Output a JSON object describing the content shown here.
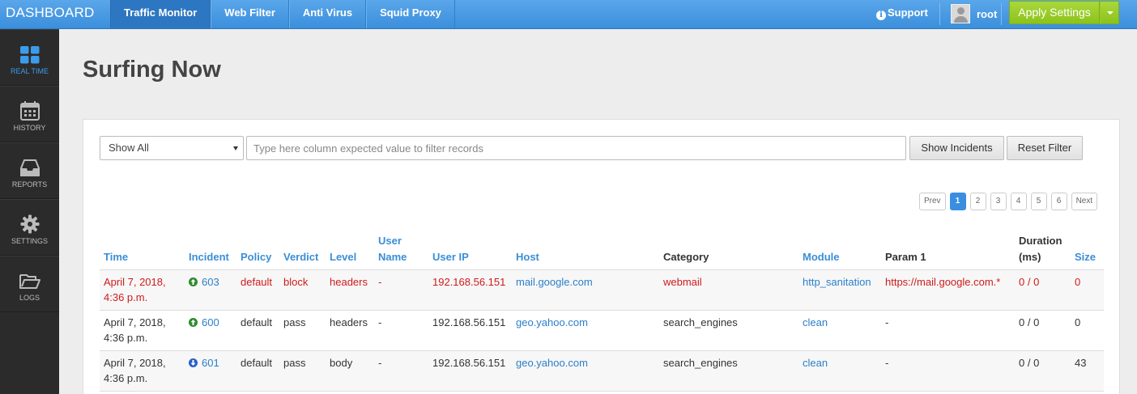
{
  "header": {
    "brand": "DASHBOARD",
    "tabs": [
      {
        "label": "Traffic Monitor",
        "active": true
      },
      {
        "label": "Web Filter"
      },
      {
        "label": "Anti Virus"
      },
      {
        "label": "Squid Proxy"
      }
    ],
    "support_label": "Support",
    "user_name": "root",
    "apply_label": "Apply Settings"
  },
  "sidebar": {
    "items": [
      {
        "label": "REAL TIME",
        "icon": "grid-icon",
        "active": true
      },
      {
        "label": "HISTORY",
        "icon": "calendar-icon"
      },
      {
        "label": "REPORTS",
        "icon": "inbox-icon"
      },
      {
        "label": "SETTINGS",
        "icon": "gear-icon"
      },
      {
        "label": "LOGS",
        "icon": "folder-icon"
      }
    ]
  },
  "main": {
    "title": "Surfing Now",
    "filter": {
      "select_value": "Show All",
      "input_placeholder": "Type here column expected value to filter records",
      "show_incidents_label": "Show Incidents",
      "reset_label": "Reset Filter"
    },
    "pager": {
      "prev": "Prev",
      "pages": [
        "1",
        "2",
        "3",
        "4",
        "5",
        "6"
      ],
      "current": "1",
      "next": "Next"
    },
    "table": {
      "headers": {
        "time": "Time",
        "incident": "Incident",
        "policy": "Policy",
        "verdict": "Verdict",
        "level": "Level",
        "user_name_1": "User",
        "user_name_2": "Name",
        "user_ip": "User IP",
        "host": "Host",
        "category": "Category",
        "module": "Module",
        "param1": "Param 1",
        "duration_1": "Duration",
        "duration_2": "(ms)",
        "size": "Size"
      },
      "rows": [
        {
          "time_1": "April 7, 2018,",
          "time_2": "4:36 p.m.",
          "incident": "603",
          "incident_dir": "up",
          "policy": "default",
          "verdict": "block",
          "level": "headers",
          "user_name": "-",
          "user_ip": "192.168.56.151",
          "host": "mail.google.com",
          "category": "webmail",
          "module": "http_sanitation",
          "param1": "https://mail.google.com.*",
          "duration": "0 / 0",
          "size": "0",
          "status_color": "#d01a1a"
        },
        {
          "time_1": "April 7, 2018,",
          "time_2": "4:36 p.m.",
          "incident": "600",
          "incident_dir": "up",
          "policy": "default",
          "verdict": "pass",
          "level": "headers",
          "user_name": "-",
          "user_ip": "192.168.56.151",
          "host": "geo.yahoo.com",
          "category": "search_engines",
          "module": "clean",
          "param1": "-",
          "duration": "0 / 0",
          "size": "0"
        },
        {
          "time_1": "April 7, 2018,",
          "time_2": "4:36 p.m.",
          "incident": "601",
          "incident_dir": "down",
          "policy": "default",
          "verdict": "pass",
          "level": "body",
          "user_name": "-",
          "user_ip": "192.168.56.151",
          "host": "geo.yahoo.com",
          "category": "search_engines",
          "module": "clean",
          "param1": "-",
          "duration": "0 / 0",
          "size": "43"
        }
      ]
    }
  }
}
